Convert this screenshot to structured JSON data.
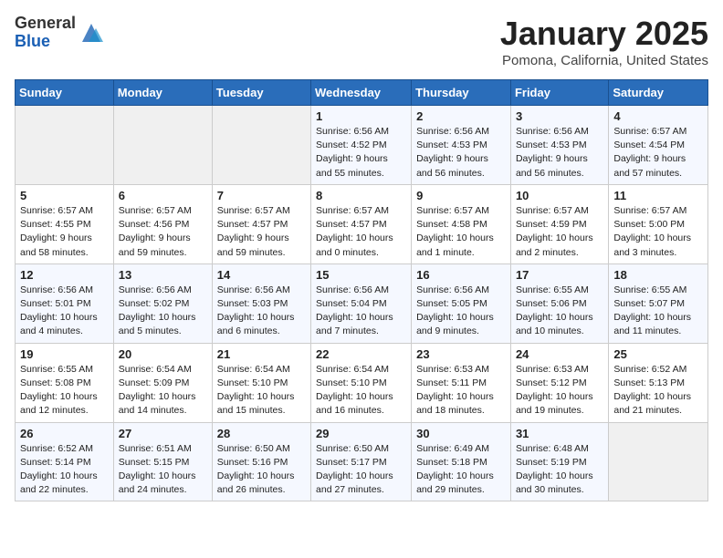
{
  "logo": {
    "general": "General",
    "blue": "Blue"
  },
  "header": {
    "month": "January 2025",
    "location": "Pomona, California, United States"
  },
  "weekdays": [
    "Sunday",
    "Monday",
    "Tuesday",
    "Wednesday",
    "Thursday",
    "Friday",
    "Saturday"
  ],
  "weeks": [
    [
      {
        "day": "",
        "info": ""
      },
      {
        "day": "",
        "info": ""
      },
      {
        "day": "",
        "info": ""
      },
      {
        "day": "1",
        "info": "Sunrise: 6:56 AM\nSunset: 4:52 PM\nDaylight: 9 hours\nand 55 minutes."
      },
      {
        "day": "2",
        "info": "Sunrise: 6:56 AM\nSunset: 4:53 PM\nDaylight: 9 hours\nand 56 minutes."
      },
      {
        "day": "3",
        "info": "Sunrise: 6:56 AM\nSunset: 4:53 PM\nDaylight: 9 hours\nand 56 minutes."
      },
      {
        "day": "4",
        "info": "Sunrise: 6:57 AM\nSunset: 4:54 PM\nDaylight: 9 hours\nand 57 minutes."
      }
    ],
    [
      {
        "day": "5",
        "info": "Sunrise: 6:57 AM\nSunset: 4:55 PM\nDaylight: 9 hours\nand 58 minutes."
      },
      {
        "day": "6",
        "info": "Sunrise: 6:57 AM\nSunset: 4:56 PM\nDaylight: 9 hours\nand 59 minutes."
      },
      {
        "day": "7",
        "info": "Sunrise: 6:57 AM\nSunset: 4:57 PM\nDaylight: 9 hours\nand 59 minutes."
      },
      {
        "day": "8",
        "info": "Sunrise: 6:57 AM\nSunset: 4:57 PM\nDaylight: 10 hours\nand 0 minutes."
      },
      {
        "day": "9",
        "info": "Sunrise: 6:57 AM\nSunset: 4:58 PM\nDaylight: 10 hours\nand 1 minute."
      },
      {
        "day": "10",
        "info": "Sunrise: 6:57 AM\nSunset: 4:59 PM\nDaylight: 10 hours\nand 2 minutes."
      },
      {
        "day": "11",
        "info": "Sunrise: 6:57 AM\nSunset: 5:00 PM\nDaylight: 10 hours\nand 3 minutes."
      }
    ],
    [
      {
        "day": "12",
        "info": "Sunrise: 6:56 AM\nSunset: 5:01 PM\nDaylight: 10 hours\nand 4 minutes."
      },
      {
        "day": "13",
        "info": "Sunrise: 6:56 AM\nSunset: 5:02 PM\nDaylight: 10 hours\nand 5 minutes."
      },
      {
        "day": "14",
        "info": "Sunrise: 6:56 AM\nSunset: 5:03 PM\nDaylight: 10 hours\nand 6 minutes."
      },
      {
        "day": "15",
        "info": "Sunrise: 6:56 AM\nSunset: 5:04 PM\nDaylight: 10 hours\nand 7 minutes."
      },
      {
        "day": "16",
        "info": "Sunrise: 6:56 AM\nSunset: 5:05 PM\nDaylight: 10 hours\nand 9 minutes."
      },
      {
        "day": "17",
        "info": "Sunrise: 6:55 AM\nSunset: 5:06 PM\nDaylight: 10 hours\nand 10 minutes."
      },
      {
        "day": "18",
        "info": "Sunrise: 6:55 AM\nSunset: 5:07 PM\nDaylight: 10 hours\nand 11 minutes."
      }
    ],
    [
      {
        "day": "19",
        "info": "Sunrise: 6:55 AM\nSunset: 5:08 PM\nDaylight: 10 hours\nand 12 minutes."
      },
      {
        "day": "20",
        "info": "Sunrise: 6:54 AM\nSunset: 5:09 PM\nDaylight: 10 hours\nand 14 minutes."
      },
      {
        "day": "21",
        "info": "Sunrise: 6:54 AM\nSunset: 5:10 PM\nDaylight: 10 hours\nand 15 minutes."
      },
      {
        "day": "22",
        "info": "Sunrise: 6:54 AM\nSunset: 5:10 PM\nDaylight: 10 hours\nand 16 minutes."
      },
      {
        "day": "23",
        "info": "Sunrise: 6:53 AM\nSunset: 5:11 PM\nDaylight: 10 hours\nand 18 minutes."
      },
      {
        "day": "24",
        "info": "Sunrise: 6:53 AM\nSunset: 5:12 PM\nDaylight: 10 hours\nand 19 minutes."
      },
      {
        "day": "25",
        "info": "Sunrise: 6:52 AM\nSunset: 5:13 PM\nDaylight: 10 hours\nand 21 minutes."
      }
    ],
    [
      {
        "day": "26",
        "info": "Sunrise: 6:52 AM\nSunset: 5:14 PM\nDaylight: 10 hours\nand 22 minutes."
      },
      {
        "day": "27",
        "info": "Sunrise: 6:51 AM\nSunset: 5:15 PM\nDaylight: 10 hours\nand 24 minutes."
      },
      {
        "day": "28",
        "info": "Sunrise: 6:50 AM\nSunset: 5:16 PM\nDaylight: 10 hours\nand 26 minutes."
      },
      {
        "day": "29",
        "info": "Sunrise: 6:50 AM\nSunset: 5:17 PM\nDaylight: 10 hours\nand 27 minutes."
      },
      {
        "day": "30",
        "info": "Sunrise: 6:49 AM\nSunset: 5:18 PM\nDaylight: 10 hours\nand 29 minutes."
      },
      {
        "day": "31",
        "info": "Sunrise: 6:48 AM\nSunset: 5:19 PM\nDaylight: 10 hours\nand 30 minutes."
      },
      {
        "day": "",
        "info": ""
      }
    ]
  ]
}
